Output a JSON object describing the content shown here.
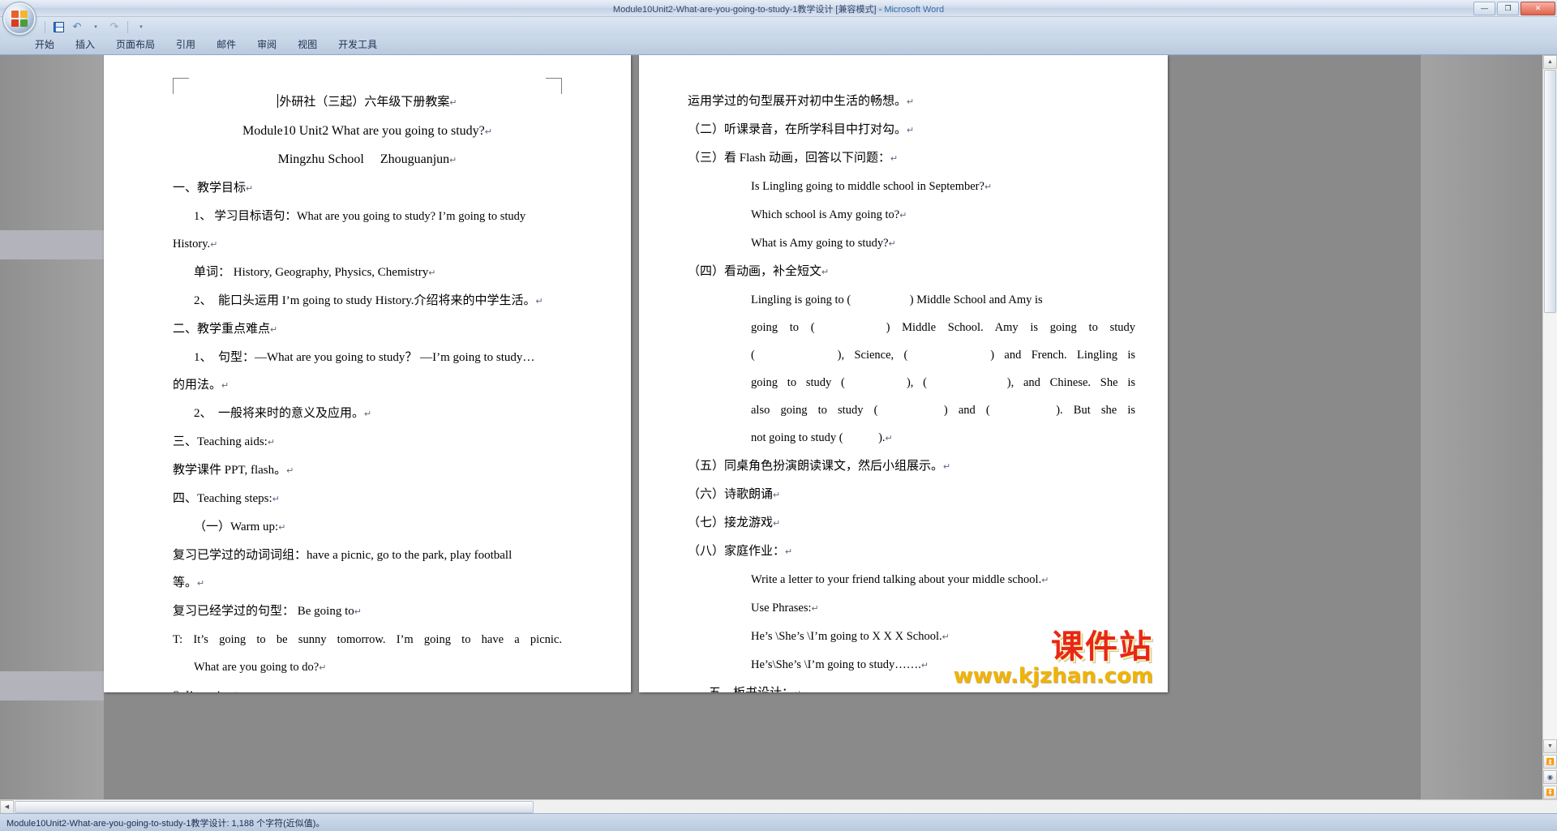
{
  "window": {
    "title_doc": "Module10Unit2-What-are-you-going-to-study-1教学设计 [兼容模式]",
    "title_sep": " - ",
    "title_app": "Microsoft Word",
    "minimize": "—",
    "maximize": "❐",
    "close": "✕"
  },
  "quick_access": {
    "save": "save-icon",
    "undo": "↶",
    "undo_dropdown": "▾",
    "redo": "↷",
    "customize": "▾"
  },
  "ribbon": {
    "tabs": [
      "开始",
      "插入",
      "页面布局",
      "引用",
      "邮件",
      "审阅",
      "视图",
      "开发工具"
    ]
  },
  "document": {
    "page_left": {
      "lines": [
        {
          "text": "外研社（三起）六年级下册教案",
          "class": "ctr ttl1 cjk",
          "caret": true,
          "pilcrow": true
        },
        {
          "text": "Module10 Unit2 What are you going to study?",
          "class": "ctr ttl2",
          "pilcrow": true
        },
        {
          "text": "Mingzhu School　 Zhouguanjun",
          "class": "ctr ttl2",
          "pilcrow": true
        },
        {
          "text": "一、教学目标",
          "class": "cjk",
          "pilcrow": true
        },
        {
          "text": "1、 学习目标语句：What are you going to study? I’m going to study",
          "class": "i1"
        },
        {
          "text": "History.",
          "class": "",
          "pilcrow": true
        },
        {
          "text": "单词： History, Geography, Physics, Chemistry",
          "class": "i1 cjk",
          "pilcrow": true
        },
        {
          "text": "2、　能口头运用 I’m going to study History.介绍将来的中学生活。",
          "class": "i1 cjk",
          "pilcrow": true
        },
        {
          "text": "二、教学重点难点",
          "class": "cjk",
          "pilcrow": true
        },
        {
          "text": "1、　句型：—What are you going to study？ —I’m going to study…",
          "class": "i1 cjk"
        },
        {
          "text": "的用法。",
          "class": "cjk",
          "pilcrow": true
        },
        {
          "text": "2、　一般将来时的意义及应用。",
          "class": "i1 cjk",
          "pilcrow": true
        },
        {
          "text": "三、Teaching aids:",
          "class": "cjk",
          "pilcrow": true
        },
        {
          "text": "教学课件 PPT, flash。",
          "class": "cjk",
          "pilcrow": true
        },
        {
          "text": "四、Teaching steps:",
          "class": "cjk",
          "pilcrow": true
        },
        {
          "text": "（一）Warm up:",
          "class": "i1 cjk",
          "pilcrow": true
        },
        {
          "text": "复习已学过的动词词组：have a picnic, go to the park, play football",
          "class": "cjk"
        },
        {
          "text": "等。",
          "class": "cjk",
          "pilcrow": true
        },
        {
          "text": "复习已经学过的句型： Be going to",
          "class": "cjk",
          "pilcrow": true
        },
        {
          "text": "T: It’s going to be sunny tomorrow. I’m going to have a picnic.",
          "class": "just"
        },
        {
          "text": "What are you going to do?",
          "class": "i1",
          "pilcrow": true
        },
        {
          "text": "S: I’m going to………",
          "class": "",
          "pilcrow": true
        }
      ]
    },
    "page_right": {
      "lines": [
        {
          "text": "运用学过的句型展开对初中生活的畅想。",
          "class": "cjk",
          "pilcrow": true
        },
        {
          "text": "（二）听课录音，在所学科目中打对勾。",
          "class": "cjk",
          "pilcrow": true
        },
        {
          "text": "（三）看 Flash 动画，回答以下问题：",
          "class": "cjk",
          "pilcrow": true
        },
        {
          "text": "Is Lingling going to middle school in September?",
          "class": "i3",
          "pilcrow": true
        },
        {
          "text": "Which school is Amy going to?",
          "class": "i3",
          "pilcrow": true
        },
        {
          "text": "What is Amy going to study?",
          "class": "i3",
          "pilcrow": true
        },
        {
          "text": "（四）看动画，补全短文",
          "class": "cjk",
          "pilcrow": true
        },
        {
          "text": "Lingling is going to (　　　　　) Middle School and Amy is",
          "class": "i3"
        },
        {
          "text": "going to (　　　) Middle School. Amy is going to study",
          "class": "i3 just"
        },
        {
          "text": "(　　　　), Science, (　　　　) and French. Lingling is",
          "class": "i3 just"
        },
        {
          "text": "going to study (　　　), (　　　　), and Chinese. She is",
          "class": "i3 just"
        },
        {
          "text": "also going to study (　　　) and (　　　). But she is",
          "class": "i3 just"
        },
        {
          "text": "not going to study (　　　).",
          "class": "i3",
          "pilcrow": true
        },
        {
          "text": "（五）同桌角色扮演朗读课文，然后小组展示。",
          "class": "cjk",
          "pilcrow": true
        },
        {
          "text": "（六）诗歌朗诵",
          "class": "cjk",
          "pilcrow": true
        },
        {
          "text": "（七）接龙游戏",
          "class": "cjk",
          "pilcrow": true
        },
        {
          "text": "（八）家庭作业：",
          "class": "cjk",
          "pilcrow": true
        },
        {
          "text": "Write a letter to your friend talking about your middle school.",
          "class": "i3",
          "pilcrow": true
        },
        {
          "text": "Use Phrases:",
          "class": "i3",
          "pilcrow": true
        },
        {
          "text": "He’s \\She’s \\I’m going to X X X School.",
          "class": "i3",
          "pilcrow": true
        },
        {
          "text": "He’s\\She’s \\I’m going to study…….",
          "class": "i3",
          "pilcrow": true
        },
        {
          "text": "五、板书设计：",
          "class": "i1 cjk",
          "pilcrow": true
        }
      ]
    }
  },
  "watermark": {
    "main": "课件站",
    "sub": "www.kjzhan.com"
  },
  "statusbar": {
    "text": "Module10Unit2-What-are-you-going-to-study-1教学设计: 1,188 个字符(近似值)。"
  },
  "scrollbars": {
    "up": "▲",
    "down": "▼",
    "prev_page": "⏫",
    "browse": "◉",
    "next_page": "⏬",
    "left": "◀",
    "right": "▶"
  }
}
